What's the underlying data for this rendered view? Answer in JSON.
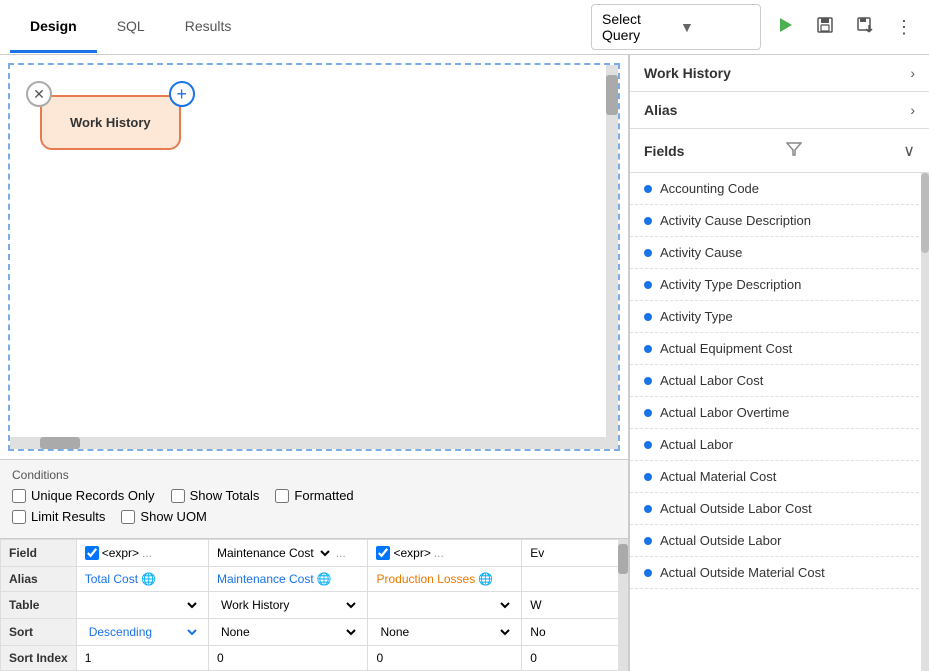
{
  "header": {
    "tabs": [
      {
        "id": "design",
        "label": "Design",
        "active": true
      },
      {
        "id": "sql",
        "label": "SQL",
        "active": false
      },
      {
        "id": "results",
        "label": "Results",
        "active": false
      }
    ],
    "select_query_placeholder": "Select Query",
    "buttons": [
      {
        "id": "run",
        "icon": "▶",
        "label": "Run"
      },
      {
        "id": "save",
        "icon": "💾",
        "label": "Save"
      },
      {
        "id": "save-as",
        "icon": "📋",
        "label": "Save As"
      },
      {
        "id": "more",
        "icon": "⋮",
        "label": "More"
      }
    ]
  },
  "canvas": {
    "node": {
      "label": "Work History"
    }
  },
  "conditions": {
    "title": "Conditions",
    "checkboxes": [
      {
        "id": "unique",
        "label": "Unique Records Only",
        "checked": false
      },
      {
        "id": "totals",
        "label": "Show Totals",
        "checked": false
      },
      {
        "id": "formatted",
        "label": "Formatted",
        "checked": false
      },
      {
        "id": "limit",
        "label": "Limit Results",
        "checked": false
      },
      {
        "id": "uom",
        "label": "Show UOM",
        "checked": false
      }
    ]
  },
  "grid": {
    "rows": [
      {
        "label": "Field",
        "cells": [
          {
            "type": "expr",
            "value": "<expr>",
            "extra": "..."
          },
          {
            "type": "select",
            "value": "Maintenance Cost",
            "arrow": "▼",
            "extra": "..."
          },
          {
            "type": "expr",
            "value": "<expr>",
            "extra": "..."
          },
          {
            "type": "text",
            "value": "Ev"
          }
        ]
      },
      {
        "label": "Alias",
        "cells": [
          {
            "type": "alias-blue",
            "value": "Total Cost",
            "globe": true
          },
          {
            "type": "alias-blue",
            "value": "Maintenance Cost",
            "globe": true
          },
          {
            "type": "alias-orange",
            "value": "Production Losses",
            "globe": true
          }
        ]
      },
      {
        "label": "Table",
        "cells": [
          {
            "type": "select",
            "value": "",
            "arrow": "▼"
          },
          {
            "type": "select",
            "value": "Work History",
            "arrow": "▼"
          },
          {
            "type": "select",
            "value": "",
            "arrow": "▼"
          },
          {
            "type": "text",
            "value": "W"
          }
        ]
      },
      {
        "label": "Sort",
        "cells": [
          {
            "type": "select",
            "value": "Descending",
            "arrow": "▼"
          },
          {
            "type": "select",
            "value": "None",
            "arrow": "▼"
          },
          {
            "type": "select",
            "value": "None",
            "arrow": "▼"
          },
          {
            "type": "text",
            "value": "No"
          }
        ]
      },
      {
        "label": "Sort Index",
        "cells": [
          {
            "type": "text",
            "value": "1"
          },
          {
            "type": "text",
            "value": "0"
          },
          {
            "type": "text",
            "value": "0"
          },
          {
            "type": "text",
            "value": "0"
          }
        ]
      }
    ]
  },
  "right_panel": {
    "sections": [
      {
        "id": "work-history",
        "label": "Work History",
        "chevron": "›"
      },
      {
        "id": "alias",
        "label": "Alias",
        "chevron": "›"
      }
    ],
    "fields_label": "Fields",
    "fields_chevron": "∨",
    "filter_icon": "⊿",
    "fields": [
      {
        "id": "accounting-code",
        "name": "Accounting Code"
      },
      {
        "id": "activity-cause-desc",
        "name": "Activity Cause Description"
      },
      {
        "id": "activity-cause",
        "name": "Activity Cause"
      },
      {
        "id": "activity-type-desc",
        "name": "Activity Type Description"
      },
      {
        "id": "activity-type",
        "name": "Activity Type"
      },
      {
        "id": "actual-equipment-cost",
        "name": "Actual Equipment Cost"
      },
      {
        "id": "actual-labor-cost",
        "name": "Actual Labor Cost"
      },
      {
        "id": "actual-labor-overtime",
        "name": "Actual Labor Overtime"
      },
      {
        "id": "actual-labor",
        "name": "Actual Labor"
      },
      {
        "id": "actual-material-cost",
        "name": "Actual Material Cost"
      },
      {
        "id": "actual-outside-labor-cost",
        "name": "Actual Outside Labor Cost"
      },
      {
        "id": "actual-outside-labor",
        "name": "Actual Outside Labor"
      },
      {
        "id": "actual-outside-material-cost",
        "name": "Actual Outside Material Cost"
      }
    ]
  }
}
